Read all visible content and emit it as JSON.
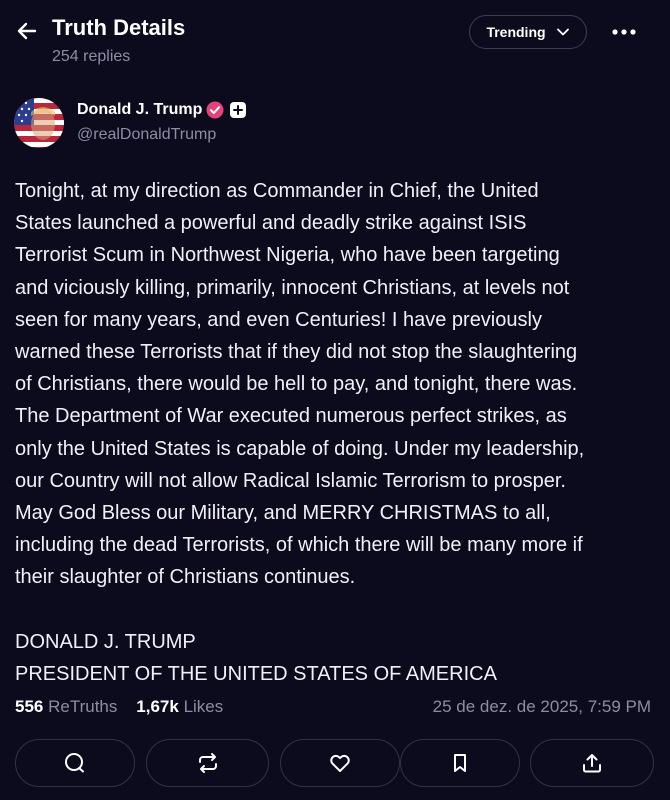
{
  "header": {
    "title": "Truth Details",
    "subtitle": "254 replies",
    "trending_label": "Trending"
  },
  "post": {
    "author": {
      "name": "Donald J. Trump",
      "handle": "@realDonaldTrump"
    },
    "body": "Tonight, at my direction as Commander in Chief, the United\nStates launched a powerful and deadly strike against ISIS\nTerrorist Scum in Northwest Nigeria, who have been targeting\nand viciously killing, primarily, innocent Christians, at levels not\nseen for many years, and even Centuries! I have previously\nwarned these Terrorists that if they did not stop the slaughtering\nof Christians, there would be hell to pay, and tonight, there was.\nThe Department of War executed numerous perfect strikes, as\nonly the United States is capable of doing. Under my leadership,\nour Country will not allow Radical Islamic Terrorism to prosper.\nMay God Bless our Military, and MERRY CHRISTMAS to all,\nincluding the dead Terrorists, of which there will be many more if\ntheir slaughter of Christians continues.\n\nDONALD J. TRUMP\nPRESIDENT OF THE UNITED STATES OF AMERICA",
    "retruths_count": "556",
    "retruths_label": "ReTruths",
    "likes_count": "1,67k",
    "likes_label": "Likes",
    "timestamp": "25 de dez. de 2025, 7:59 PM"
  },
  "icons": {
    "back": "arrow-left-icon",
    "trending_chevron": "chevron-down-icon",
    "more": "more-dots-icon",
    "verified": "verified-badge-icon",
    "plus": "plus-icon",
    "reply": "reply-icon",
    "retruth": "retruth-icon",
    "like": "heart-icon",
    "bookmark": "bookmark-icon",
    "share": "share-icon"
  },
  "colors": {
    "background": "#0c0b1e",
    "verified": "#e0457b",
    "muted_text": "#8e8ca3",
    "button_border": "#33314a"
  }
}
